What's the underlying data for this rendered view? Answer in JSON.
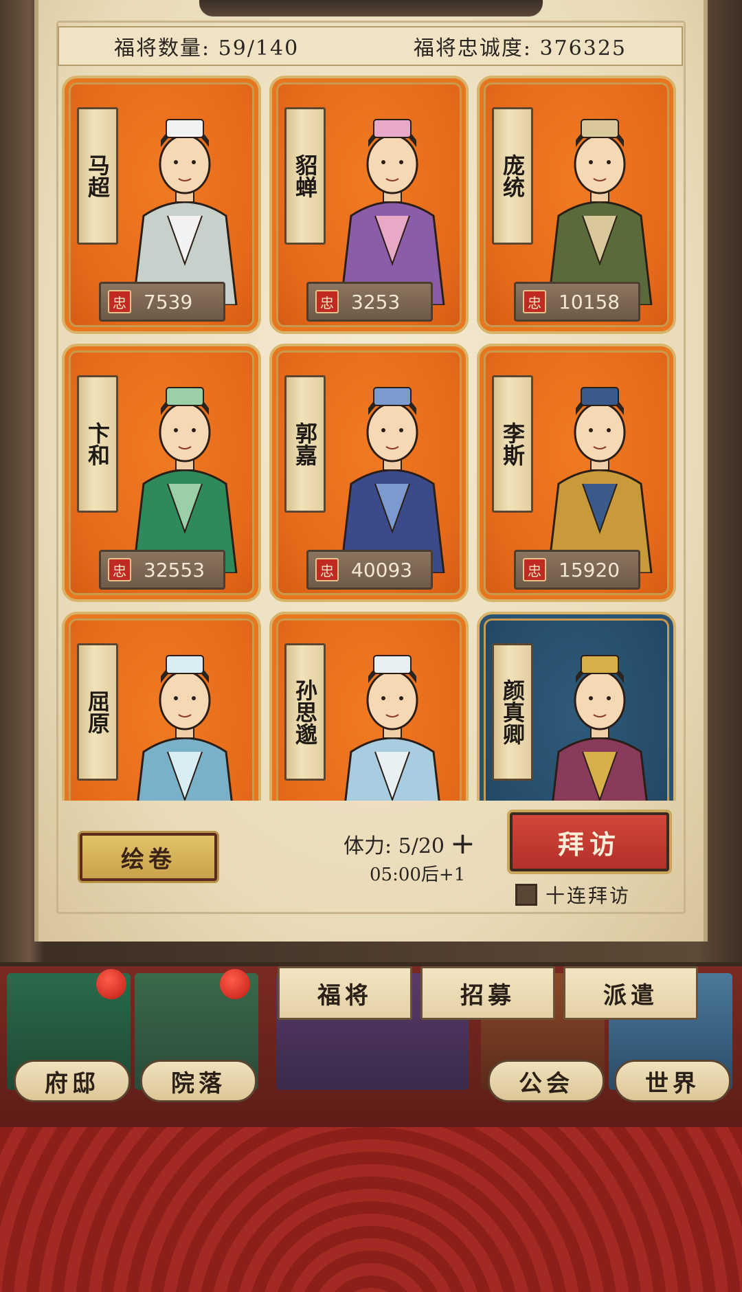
{
  "stats": {
    "count_label": "福将数量: 59/140",
    "loyalty_label": "福将忠诚度: 376325"
  },
  "loyalty_seal": "忠",
  "cards": [
    {
      "name": "马超",
      "loyalty": "7539",
      "theme": "orange",
      "robe": "#c8d0cc",
      "accent": "#f2f2f2"
    },
    {
      "name": "貂蝉",
      "loyalty": "3253",
      "theme": "orange",
      "robe": "#8b5ca8",
      "accent": "#e8a8c8"
    },
    {
      "name": "庞统",
      "loyalty": "10158",
      "theme": "orange",
      "robe": "#5a6a3a",
      "accent": "#d8c89a"
    },
    {
      "name": "卞和",
      "loyalty": "32553",
      "theme": "orange",
      "robe": "#2e8a5a",
      "accent": "#9ad0a8"
    },
    {
      "name": "郭嘉",
      "loyalty": "40093",
      "theme": "orange",
      "robe": "#3a4a8a",
      "accent": "#7a9ad0"
    },
    {
      "name": "李斯",
      "loyalty": "15920",
      "theme": "orange",
      "robe": "#c89a3a",
      "accent": "#3a5a8a"
    },
    {
      "name": "屈原",
      "loyalty": "",
      "theme": "orange",
      "robe": "#7ab0c8",
      "accent": "#d8eef4"
    },
    {
      "name": "孙思邈",
      "loyalty": "",
      "theme": "orange",
      "robe": "#a8cce0",
      "accent": "#e8f0f4"
    },
    {
      "name": "颜真卿",
      "loyalty": "",
      "theme": "blue",
      "robe": "#8a3a5a",
      "accent": "#d8b04a"
    }
  ],
  "actions": {
    "scroll_label": "绘卷",
    "stamina_label": "体力: 5/20",
    "stamina_plus": "+",
    "stamina_timer": "05:00后+1",
    "visit_label": "拜访",
    "ten_visit_label": "十连拜访"
  },
  "tabs": [
    "福将",
    "招募",
    "派遣"
  ],
  "locations": [
    "府邸",
    "院落",
    "公会",
    "世界"
  ]
}
